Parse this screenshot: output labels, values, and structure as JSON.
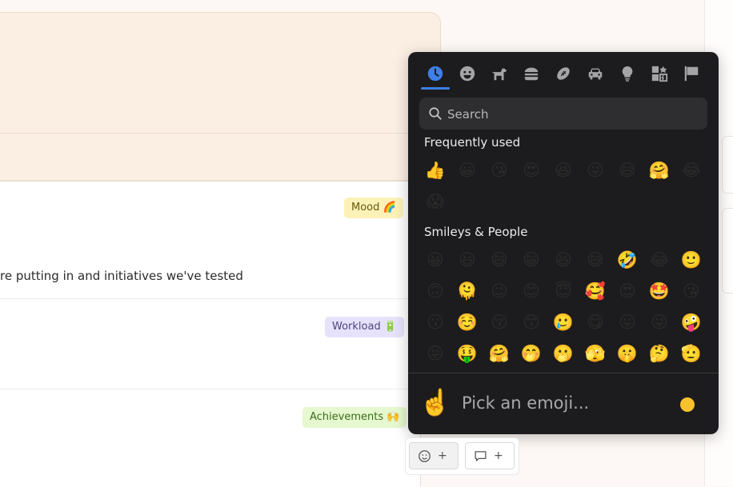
{
  "document": {
    "tags": {
      "mood": "Mood 🌈",
      "workload": "Workload 🔋",
      "achievements": "Achievements 🙌"
    },
    "body_text": "re putting in and initiatives we've tested"
  },
  "picker": {
    "categories": [
      {
        "name": "recent",
        "icon": "clock-icon",
        "active": true
      },
      {
        "name": "smileys",
        "icon": "smiley-icon"
      },
      {
        "name": "animals",
        "icon": "dog-icon"
      },
      {
        "name": "food",
        "icon": "burger-icon"
      },
      {
        "name": "activities",
        "icon": "football-icon"
      },
      {
        "name": "travel",
        "icon": "car-icon"
      },
      {
        "name": "objects",
        "icon": "lightbulb-icon"
      },
      {
        "name": "symbols",
        "icon": "symbols-icon"
      },
      {
        "name": "flags",
        "icon": "flag-icon"
      }
    ],
    "search": {
      "placeholder": "Search",
      "value": ""
    },
    "sections": {
      "frequent": {
        "title": "Frequently used",
        "emojis": [
          "👍",
          "😀",
          "😘",
          "😍",
          "😆",
          "😜",
          "😅",
          "🤗",
          "😂",
          "😱"
        ]
      },
      "smileys": {
        "title": "Smileys & People",
        "emojis": [
          "😀",
          "😃",
          "😄",
          "😁",
          "😆",
          "😅",
          "🤣",
          "😂",
          "🙂",
          "🙃",
          "🫠",
          "😉",
          "😊",
          "😇",
          "🥰",
          "😍",
          "🤩",
          "😘",
          "😗",
          "☺️",
          "😚",
          "😙",
          "🥲",
          "😋",
          "😛",
          "😜",
          "🤪",
          "😝",
          "🤑",
          "🤗",
          "🤭",
          "🫢",
          "🫣",
          "🤫",
          "🤔",
          "🫡"
        ]
      }
    },
    "preview": {
      "emoji": "☝️",
      "label": "Pick an emoji..."
    },
    "skin_tone": {
      "color": "#f7c22b"
    }
  },
  "toolbar": {
    "emoji_plus": "+",
    "comment_plus": "+"
  }
}
